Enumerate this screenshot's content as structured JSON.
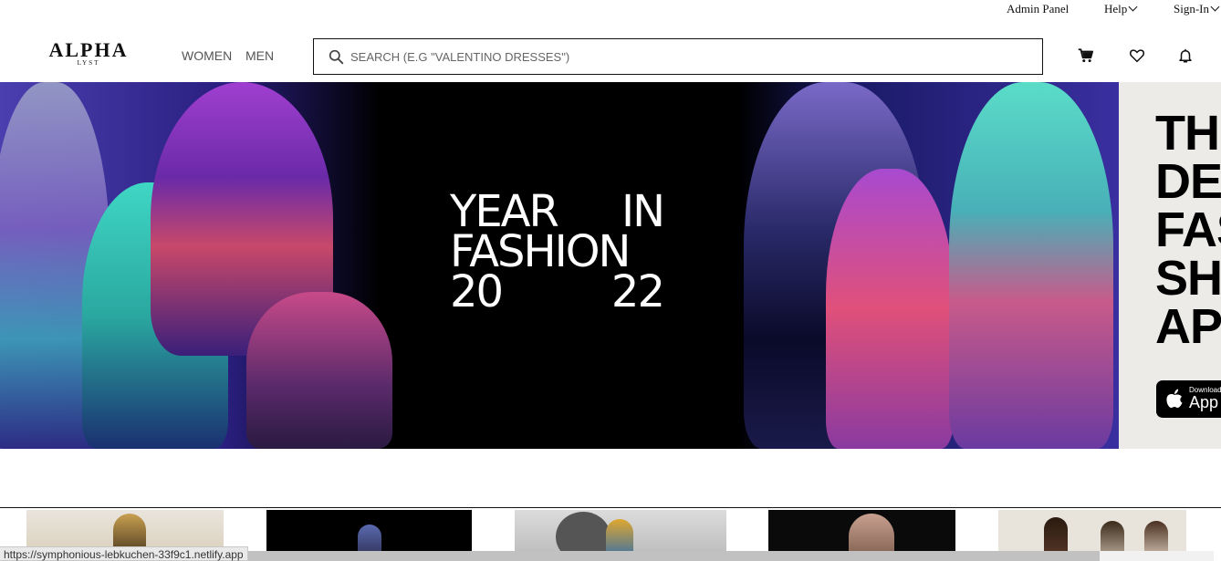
{
  "utility_nav": {
    "admin_panel": "Admin Panel",
    "help": "Help",
    "sign_in": "Sign-In"
  },
  "header": {
    "logo_main": "ALPHA",
    "logo_sub": "LYST",
    "nav": [
      "WOMEN",
      "MEN"
    ],
    "search_placeholder": "SEARCH (E.G \"VALENTINO DRESSES\")",
    "icons": [
      "cart-icon",
      "heart-icon",
      "bell-icon"
    ]
  },
  "hero": {
    "line1_left": "YEAR",
    "line1_right": "IN",
    "line2": "FASHION",
    "line3_left": "20",
    "line3_right": "22"
  },
  "side_promo": {
    "text": "TH\nDE\nFAS\nSH\nAP",
    "download_label": "Download",
    "app_label": "App"
  },
  "status_bar": {
    "url": "https://symphonious-lebkuchen-33f9c1.netlify.app"
  },
  "colors": {
    "accent_text": "#111111",
    "hero_background": "#000000",
    "promo_background": "#ecebe8"
  }
}
